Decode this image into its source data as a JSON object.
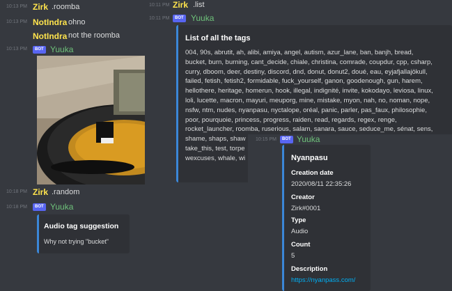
{
  "chat_left": {
    "messages": [
      {
        "time": "10:13 PM",
        "author": "Zirk",
        "text": ".roomba"
      },
      {
        "time": "10:13 PM",
        "author": "NotIndra",
        "text": "ohno"
      },
      {
        "author": "NotIndra",
        "text": "not the roomba"
      },
      {
        "time": "10:13 PM",
        "author": "Yuuka",
        "badge": "BOT"
      },
      {
        "time": "10:18 PM",
        "author": "Zirk",
        "text": ".random"
      },
      {
        "time": "10:18 PM",
        "author": "Yuuka",
        "badge": "BOT"
      }
    ],
    "audio_embed": {
      "title": "Audio tag suggestion",
      "description": "Why not trying \"bucket\""
    }
  },
  "chat_list": {
    "msg1": {
      "time": "10:11 PM",
      "author": "Zirk",
      "text": ".list"
    },
    "msg2": {
      "time": "10:11 PM",
      "author": "Yuuka",
      "badge": "BOT"
    },
    "embed": {
      "title": "List of all the tags",
      "lines": [
        "004, 90s, abrutit, ah, alibi, amiya, angel, autism, azur_lane, ban, banjh, bread,",
        "bucket, burn, burning, cant_decide, chiale, christina, comrade, coupdur, cpp, csharp,",
        "curry, dboom, deer, destiny, discord, dnd, donut, donut2, doué, eau, eyjafjallajökull,",
        "failed, fetish, fetish2, formidable, fuck_yourself, ganon, goodenough, gun, harem,",
        "hellothere, heritage, homerun, hook, illegal, indignité, invite, kokodayo, leviosa, linux,",
        "loli, lucette, macron, mayuri, meuporg, mine, mistake, myon, nah, no, noman, nope,",
        "nsfw, ntm, nudes, nyanpasu, nyctalope, oréal, panic, parler, pas_faux, philosophie,",
        "poor, pourquoie, princess, progress, raiden, read, regards, regex, renge,",
        "rocket_launcher, roomba, ruserious, salam, sanara, sauce, seduce_me, sénat, sens,",
        "shame, shaps, shaw",
        "take_this, test, torpe",
        "wexcuses, whale, wi"
      ]
    }
  },
  "chat_info": {
    "msg": {
      "time": "10:15 PM",
      "author": "Yuuka",
      "badge": "BOT"
    },
    "embed": {
      "title": "Nyanpasu",
      "fields": [
        {
          "name": "Creation date",
          "value": "2020/08/11 22:35:26"
        },
        {
          "name": "Creator",
          "value": "Zirk#0001"
        },
        {
          "name": "Type",
          "value": "Audio"
        },
        {
          "name": "Count",
          "value": "5"
        }
      ],
      "description_label": "Description",
      "description_link": "https://nyanpass.com/"
    }
  },
  "colors": {
    "background": "#36393f",
    "embed_bg": "#2f3136",
    "embed_accent": "#3b87d8",
    "username_yellow": "#ffe44d",
    "bot_green": "#6ec27a",
    "bot_badge": "#5865f2",
    "link": "#00aff4"
  }
}
